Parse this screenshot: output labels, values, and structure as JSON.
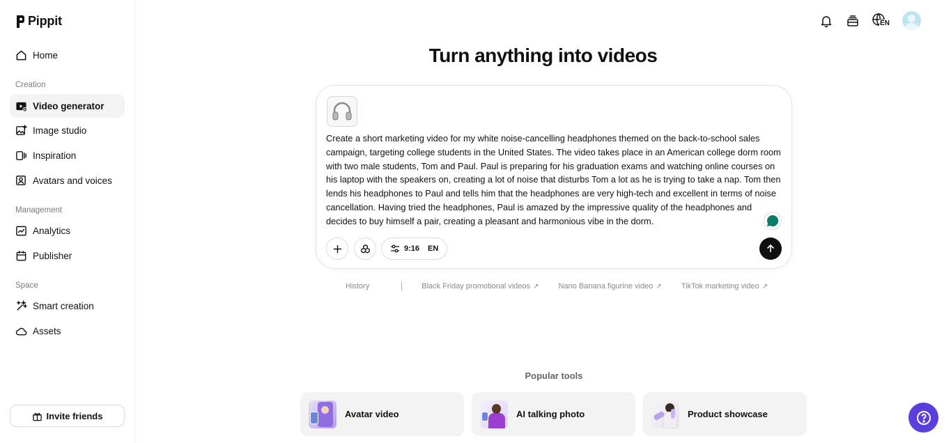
{
  "app": {
    "name": "Pippit"
  },
  "sidebar": {
    "home": "Home",
    "sections": {
      "creation": "Creation",
      "management": "Management",
      "space": "Space"
    },
    "creation_items": [
      {
        "label": "Video generator",
        "icon": "video-plus-icon"
      },
      {
        "label": "Image studio",
        "icon": "image-sparkle-icon"
      },
      {
        "label": "Inspiration",
        "icon": "inspiration-icon"
      },
      {
        "label": "Avatars and voices",
        "icon": "avatar-icon"
      }
    ],
    "management_items": [
      {
        "label": "Analytics",
        "icon": "chart-icon"
      },
      {
        "label": "Publisher",
        "icon": "calendar-icon"
      }
    ],
    "space_items": [
      {
        "label": "Smart creation",
        "icon": "magic-wand-icon"
      },
      {
        "label": "Assets",
        "icon": "cloud-icon"
      }
    ],
    "invite": "Invite friends"
  },
  "header": {
    "language": "EN",
    "icons": [
      "bell-icon",
      "stack-icon",
      "globe-icon",
      "avatar"
    ]
  },
  "main": {
    "headline": "Turn anything into videos",
    "prompt": "Create a short marketing video for my white noise-cancelling headphones themed on the back-to-school sales campaign, targeting college students in the United States. The video takes place in an American college dorm room with two male students, Tom and Paul. Paul is preparing for his graduation exams and watching online courses on his laptop with the speakers on, creating a lot of noise that disturbs Tom a lot as he is trying to take a nap. Tom then lends his headphones to Paul and tells him that the headphones are very high-tech and excellent in terms of noise cancellation. Having tried the headphones, Paul is amazed by the impressive quality of the headphones and decides to buy himself a pair, creating a pleasant and harmonious vibe in the dorm.",
    "settings": {
      "ratio": "9:16",
      "language": "EN"
    },
    "suggestions": {
      "history": "History",
      "items": [
        "Black Friday promotional videos",
        "Nano Banana figurine video",
        "TikTok marketing video"
      ],
      "arrow": "↗"
    },
    "popular_title": "Popular tools",
    "tools": [
      {
        "label": "Avatar video"
      },
      {
        "label": "AI talking photo"
      },
      {
        "label": "Product showcase"
      }
    ]
  },
  "colors": {
    "accent": "#5a3fdc",
    "send": "#0f0f0f",
    "card_bg": "#f3f3f3"
  }
}
